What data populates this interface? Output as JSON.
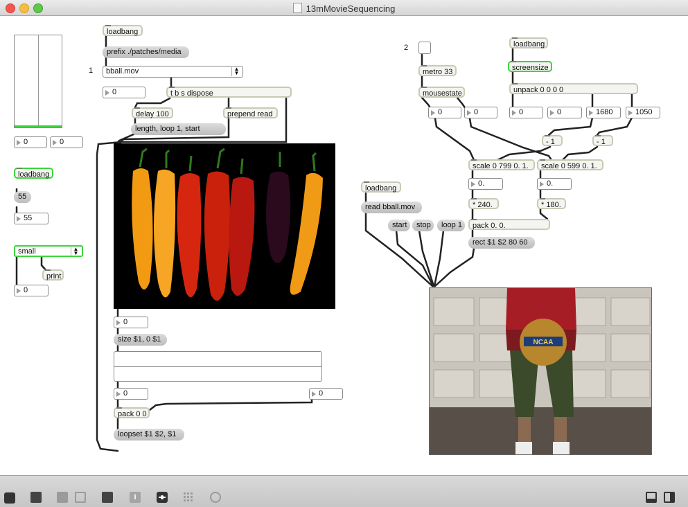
{
  "window": {
    "title": "13mMovieSequencing"
  },
  "patch": {
    "left_panel": {
      "num_a": "0",
      "num_b": "0",
      "loadbang": "loadbang",
      "msg_55": "55",
      "num_55": "55",
      "umenu_value": "small",
      "print": "print",
      "num_c": "0"
    },
    "movie_chain": {
      "loadbang": "loadbang",
      "prefix_msg": "prefix ./patches/media",
      "comment_1": "1",
      "umenu_value": "bball.mov",
      "num_menu": "0",
      "tbs": "t b s dispose",
      "delay": "delay 100",
      "prepend": "prepend read",
      "length_msg": "length, loop 1, start",
      "num_size": "0",
      "size_msg": "size $1, 0 $1",
      "num_left": "0",
      "num_right": "0",
      "pack": "pack 0 0",
      "loopset_msg": "loopset $1 $2, $1"
    },
    "mouse_chain": {
      "comment_2": "2",
      "metro": "metro 33",
      "mousestate": "mousestate",
      "num_mx": "0",
      "num_my": "0",
      "loadbang": "loadbang",
      "screensize": "screensize",
      "unpack": "unpack 0 0 0 0",
      "num_u1": "0",
      "num_u2": "0",
      "num_u3": "1680",
      "num_u4": "1050",
      "minus_1a": "- 1",
      "minus_1b": "- 1",
      "scale_x": "scale 0 799 0. 1.",
      "scale_y": "scale 0 599 0. 1.",
      "flt_x": "0.",
      "flt_y": "0.",
      "mul_x": "* 240.",
      "mul_y": "* 180.",
      "pack2": "pack 0. 0.",
      "rect_msg": "rect $1 $2 80 60"
    },
    "movie2_chain": {
      "loadbang": "loadbang",
      "read_msg": "read bball.mov",
      "start": "start",
      "stop": "stop",
      "loop1": "loop 1"
    }
  },
  "toolbar": {
    "icons": [
      "lock-icon",
      "presentation-icon",
      "clipboard-icon",
      "close-box-icon",
      "inspector-icon",
      "info-icon",
      "connect-icon",
      "grid-icon",
      "snapshot-icon",
      "split-view-icon",
      "sidebar-icon"
    ]
  },
  "colors": {
    "green_outline": "#3dd43d",
    "object_border": "#c9c9b5",
    "message_fill": "#c8c8c8",
    "wire": "#222222"
  }
}
